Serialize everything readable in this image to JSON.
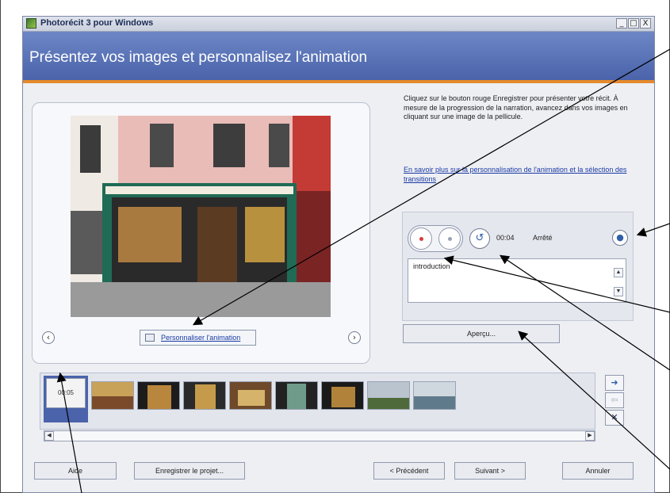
{
  "window": {
    "title": "Photorécit 3 pour Windows",
    "controls": [
      "_",
      "□",
      "X"
    ]
  },
  "header": {
    "title": "Présentez vos images et personnalisez l'animation"
  },
  "image_panel": {
    "customize_label": "Personnaliser l'animation",
    "prev_icon": "chevron-left-icon",
    "next_icon": "chevron-right-icon"
  },
  "instructions": {
    "text": "Cliquez sur le bouton rouge Enregistrer pour présenter votre récit. À mesure de la progression de la narration, avancez dans vos images en cliquant sur une image de la pellicule.",
    "link": "En savoir plus sur la personnalisation de l'animation et la sélection des transitions"
  },
  "narration": {
    "time": "00:04",
    "status": "Arrêté",
    "text": "introduction"
  },
  "preview": {
    "label": "Aperçu..."
  },
  "filmstrip": {
    "selected_duration": "00:05"
  },
  "footer": {
    "help": "Aide",
    "save_project": "Enregistrer le projet...",
    "previous": "< Précédent",
    "next": "Suivant >",
    "cancel": "Annuler"
  },
  "colors": {
    "header": "#4a63aa",
    "accent": "#e58a2c",
    "link": "#1a3aa5",
    "record": "#d63b3b"
  }
}
